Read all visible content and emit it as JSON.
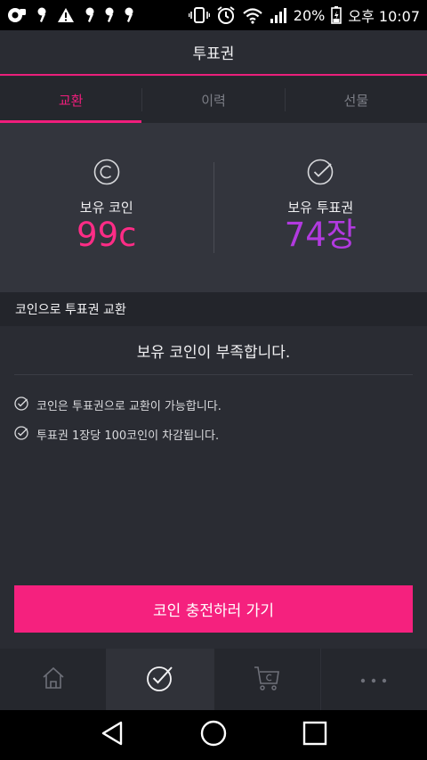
{
  "status_bar": {
    "battery": "20%",
    "time": "오후 10:07"
  },
  "header": {
    "title": "투표권"
  },
  "tabs": [
    {
      "label": "교환",
      "active": true
    },
    {
      "label": "이력",
      "active": false
    },
    {
      "label": "선물",
      "active": false
    }
  ],
  "summary": {
    "coins": {
      "label": "보유 코인",
      "value": "99c",
      "icon": "coin-c-icon",
      "color": "#ff2c86"
    },
    "tickets": {
      "label": "보유 투표권",
      "value": "74장",
      "icon": "check-circle-icon",
      "color": "#b23ae0"
    }
  },
  "section": {
    "title": "코인으로 투표권 교환"
  },
  "message": "보유 코인이 부족합니다.",
  "notes": [
    "코인은 투표권으로 교환이 가능합니다.",
    "투표권 1장당 100코인이 차감됩니다."
  ],
  "cta": {
    "label": "코인 충전하러 가기",
    "color": "#f5217e"
  },
  "bottom_nav": [
    {
      "name": "home-icon",
      "active": false
    },
    {
      "name": "check-circle-icon",
      "active": true
    },
    {
      "name": "coin-cart-icon",
      "active": false
    },
    {
      "name": "more-icon",
      "active": false
    }
  ],
  "colors": {
    "accent": "#f01d7c",
    "background": "#2a2c33"
  }
}
